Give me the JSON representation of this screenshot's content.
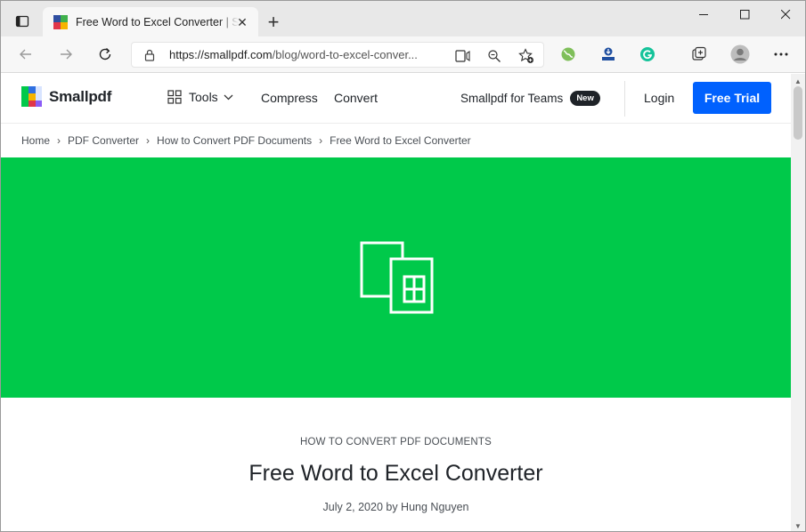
{
  "browser": {
    "tab_title": "Free Word to Excel Converter | Smallpdf",
    "tab_close": "✕",
    "new_tab": "+",
    "url_host": "https://smallpdf.com",
    "url_path": "/blog/word-to-excel-conver..."
  },
  "site": {
    "logo_text": "Smallpdf",
    "nav": {
      "tools": "Tools",
      "compress": "Compress",
      "convert": "Convert",
      "teams": "Smallpdf for Teams",
      "teams_badge": "New",
      "login": "Login",
      "free_trial": "Free Trial"
    },
    "breadcrumb": [
      "Home",
      "PDF Converter",
      "How to Convert PDF Documents",
      "Free Word to Excel Converter"
    ],
    "breadcrumb_sep": "›"
  },
  "article": {
    "category": "HOW TO CONVERT PDF DOCUMENTS",
    "title": "Free Word to Excel Converter",
    "meta": "July 2, 2020 by Hung Nguyen"
  },
  "colors": {
    "hero": "#00c94a",
    "primary_button": "#0061fe",
    "chrome": "#e8e8e8"
  }
}
